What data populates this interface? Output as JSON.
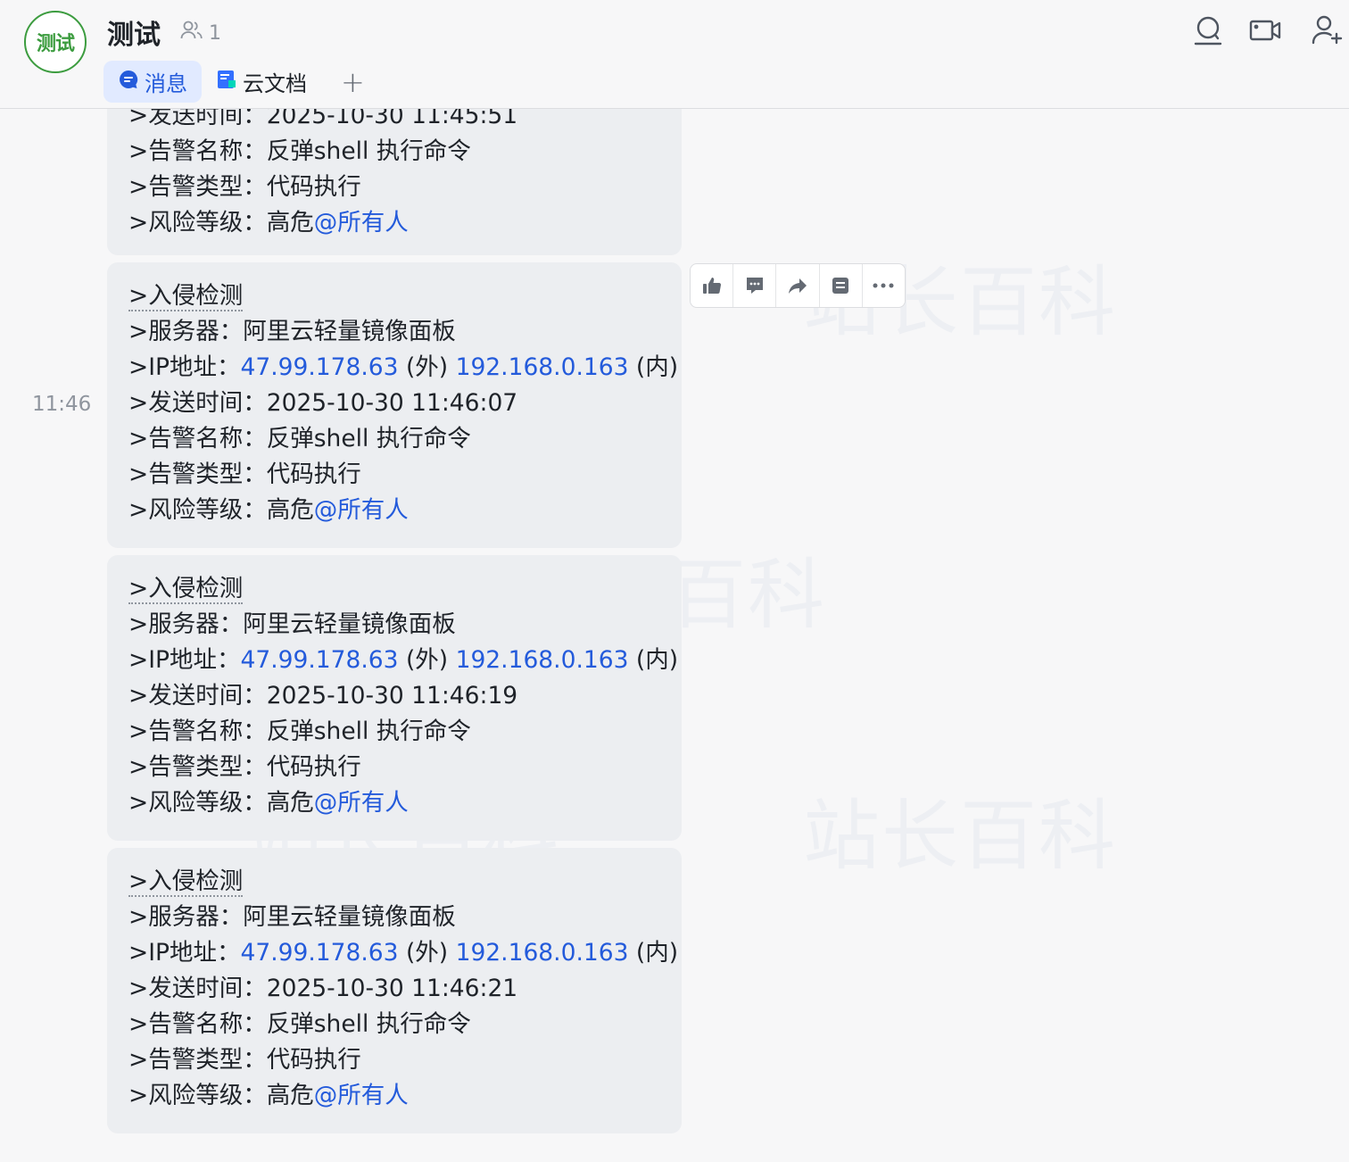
{
  "header": {
    "avatar_text": "测试",
    "title": "测试",
    "member_count": "1",
    "tabs": [
      {
        "label": "消息",
        "active": true
      },
      {
        "label": "云文档",
        "active": false
      }
    ],
    "add_tab": "+"
  },
  "time_label": "11:46",
  "watermark": "站长百科",
  "messages": [
    {
      "partial": true,
      "send_time_line": ">发送时间：2025-10-30 11:45:51",
      "alert_name_prefix": ">告警名称：",
      "alert_name": "反弹shell 执行命令",
      "alert_type_prefix": ">告警类型：",
      "alert_type": "代码执行",
      "risk_prefix": ">风险等级：",
      "risk": "高危",
      "mention": "@所有人"
    },
    {
      "head": ">入侵检测",
      "server_prefix": ">服务器：",
      "server": "阿里云轻量镜像面板",
      "ip_prefix": ">IP地址：",
      "ip_ext": "47.99.178.63",
      "ip_ext_tag": "(外)",
      "ip_int": "192.168.0.163",
      "ip_int_tag": "(内)",
      "send_time_prefix": ">发送时间：",
      "send_time": "2025-10-30 11:46:07",
      "alert_name_prefix": ">告警名称：",
      "alert_name": "反弹shell 执行命令",
      "alert_type_prefix": ">告警类型：",
      "alert_type": "代码执行",
      "risk_prefix": ">风险等级：",
      "risk": "高危",
      "mention": "@所有人"
    },
    {
      "head": ">入侵检测",
      "server_prefix": ">服务器：",
      "server": "阿里云轻量镜像面板",
      "ip_prefix": ">IP地址：",
      "ip_ext": "47.99.178.63",
      "ip_ext_tag": "(外)",
      "ip_int": "192.168.0.163",
      "ip_int_tag": "(内)",
      "send_time_prefix": ">发送时间：",
      "send_time": "2025-10-30 11:46:19",
      "alert_name_prefix": ">告警名称：",
      "alert_name": "反弹shell 执行命令",
      "alert_type_prefix": ">告警类型：",
      "alert_type": "代码执行",
      "risk_prefix": ">风险等级：",
      "risk": "高危",
      "mention": "@所有人"
    },
    {
      "head": ">入侵检测",
      "server_prefix": ">服务器：",
      "server": "阿里云轻量镜像面板",
      "ip_prefix": ">IP地址：",
      "ip_ext": "47.99.178.63",
      "ip_ext_tag": "(外)",
      "ip_int": "192.168.0.163",
      "ip_int_tag": "(内)",
      "send_time_prefix": ">发送时间：",
      "send_time": "2025-10-30 11:46:21",
      "alert_name_prefix": ">告警名称：",
      "alert_name": "反弹shell 执行命令",
      "alert_type_prefix": ">告警类型：",
      "alert_type": "代码执行",
      "risk_prefix": ">风险等级：",
      "risk": "高危",
      "mention": "@所有人"
    }
  ],
  "icons": {
    "header": [
      "search-icon",
      "video-icon",
      "add-member-icon"
    ],
    "toolbar": [
      "thumbs-up-icon",
      "reply-icon",
      "forward-icon",
      "pin-icon",
      "more-icon"
    ]
  },
  "colors": {
    "accent": "#245bdb",
    "avatar": "#3c9c3f",
    "bubble": "#eceef1",
    "background": "#f7f7f8"
  }
}
